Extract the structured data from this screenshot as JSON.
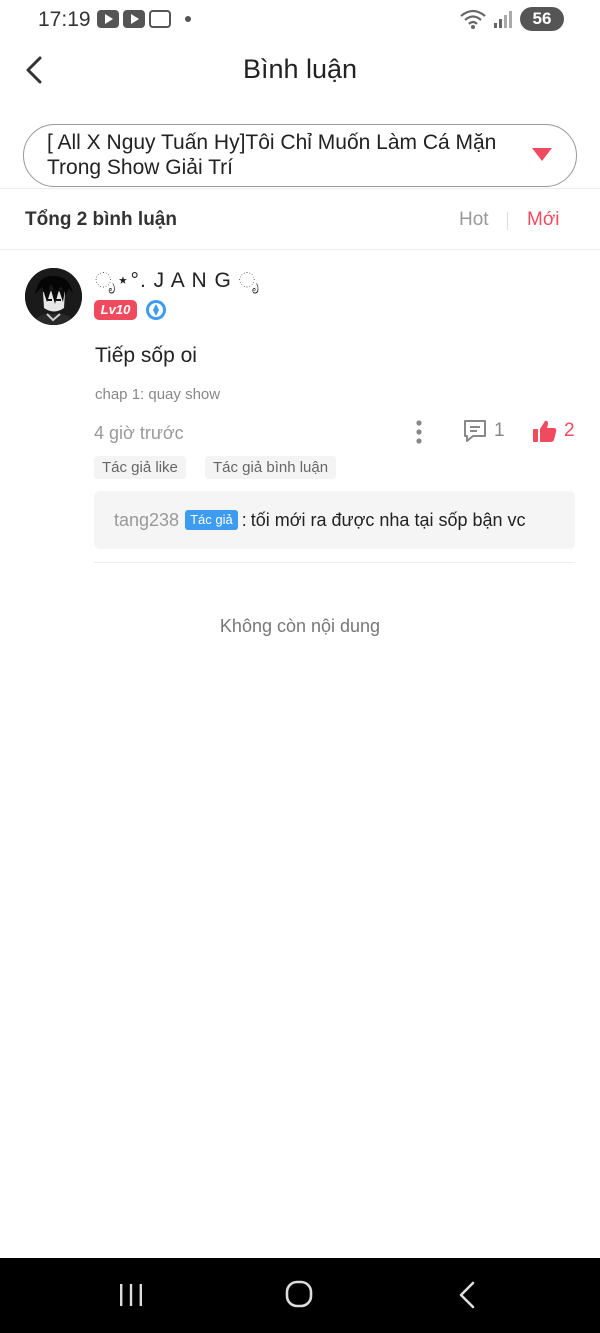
{
  "status_bar": {
    "time": "17:19",
    "battery": "56",
    "app_icons": [
      "youtube-icon",
      "youtube-icon",
      "message-app-icon"
    ]
  },
  "header": {
    "title": "Bình luận"
  },
  "story_selector": {
    "title": "[ All X Nguy Tuấn Hy]Tôi Chỉ Muốn Làm Cá Mặn Trong Show Giải Trí"
  },
  "sort_bar": {
    "total_label": "Tổng 2 bình luận",
    "options": [
      "Hot",
      "Mới"
    ],
    "selected": "Mới"
  },
  "comment": {
    "username": "ೃ⋆°. J A N G ೃ",
    "level": "Lv10",
    "text": "Tiếp sốp oi",
    "chapter": "chap 1: quay show",
    "time": "4 giờ trước",
    "reply_count": "1",
    "like_count": "2",
    "tags": [
      "Tác giả like",
      "Tác giả bình luận"
    ],
    "reply": {
      "user": "tang238",
      "badge": "Tác giả",
      "colon": ":",
      "text": "tối mới ra được nha tại sốp bận vc"
    }
  },
  "footer_text": "Không còn nội dung",
  "colors": {
    "accent": "#f04a5f",
    "author_badge": "#3d9bf0"
  }
}
